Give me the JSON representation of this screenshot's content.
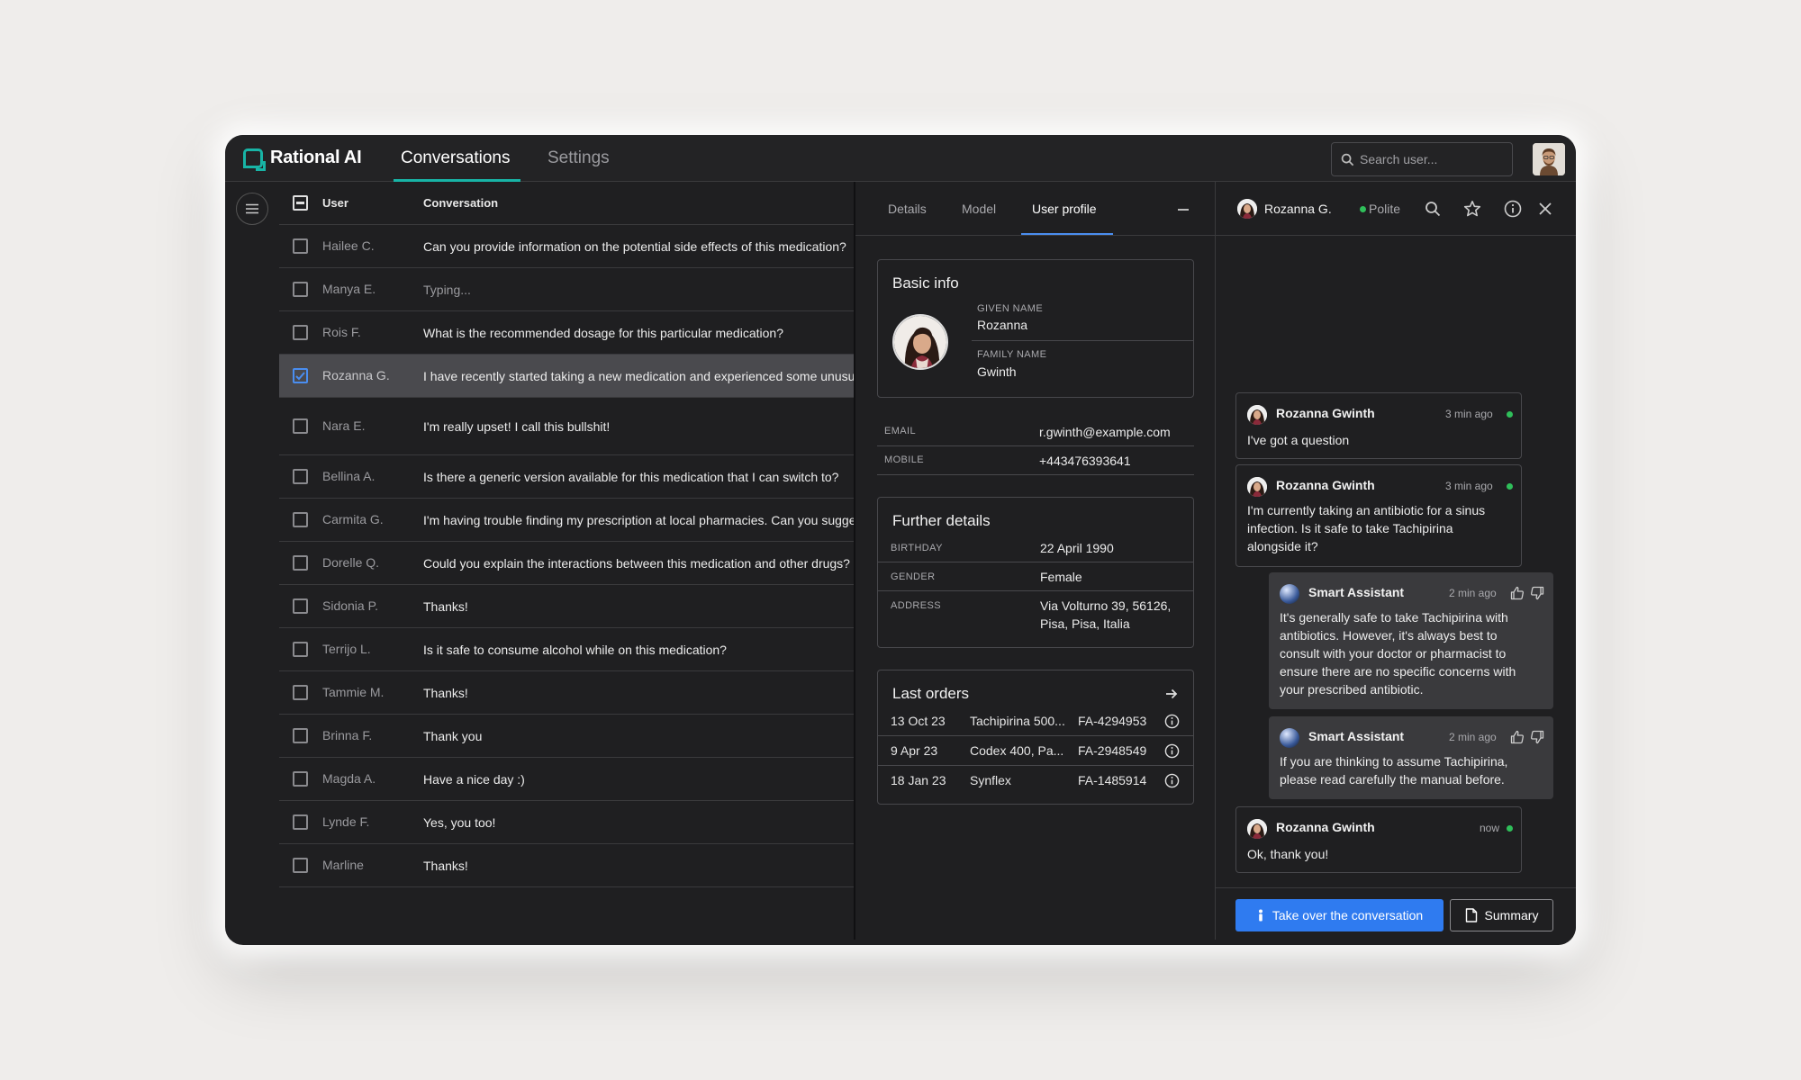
{
  "app": {
    "name": "Rational AI"
  },
  "nav": {
    "tabs": [
      "Conversations",
      "Settings"
    ]
  },
  "search": {
    "placeholder": "Search user..."
  },
  "table": {
    "headers": {
      "user": "User",
      "conversation": "Conversation"
    },
    "rows": [
      {
        "user": "Hailee C.",
        "text": "Can you provide information on the potential side effects of this medication?"
      },
      {
        "user": "Manya E.",
        "text": "Typing..."
      },
      {
        "user": "Rois F.",
        "text": "What is the recommended dosage for this particular medication?"
      },
      {
        "user": "Rozanna G.",
        "text": "I have recently started taking a new medication and experienced some unusual symptoms"
      },
      {
        "user": "Nara E.",
        "text": "I'm really upset! I call this bullshit!"
      },
      {
        "user": "Bellina A.",
        "text": "Is there a generic version available for this medication that I can switch to?"
      },
      {
        "user": "Carmita G.",
        "text": "I'm having trouble finding my prescription at local pharmacies. Can you suggest"
      },
      {
        "user": "Dorelle Q.",
        "text": "Could you explain the interactions between this medication and other drugs?"
      },
      {
        "user": "Sidonia P.",
        "text": "Thanks!"
      },
      {
        "user": "Terrijo L.",
        "text": "Is it safe to consume alcohol while on this medication?"
      },
      {
        "user": "Tammie M.",
        "text": "Thanks!"
      },
      {
        "user": "Brinna F.",
        "text": "Thank you"
      },
      {
        "user": "Magda A.",
        "text": "Have a nice day :)"
      },
      {
        "user": "Lynde F.",
        "text": "Yes, you too!"
      },
      {
        "user": "Marline",
        "text": "Thanks!"
      }
    ]
  },
  "profile": {
    "tabs": [
      "Details",
      "Model",
      "User profile"
    ],
    "basic_info": {
      "title": "Basic info",
      "given_label": "GIVEN NAME",
      "given": "Rozanna",
      "family_label": "FAMILY NAME",
      "family": "Gwinth"
    },
    "contact": {
      "email_label": "EMAIL",
      "email": "r.gwinth@example.com",
      "mobile_label": "MOBILE",
      "mobile": "+443476393641"
    },
    "further": {
      "title": "Further details",
      "birthday_label": "BIRTHDAY",
      "birthday": "22 April 1990",
      "gender_label": "GENDER",
      "gender": "Female",
      "address_label": "ADDRESS",
      "address_line1": "Via Volturno 39, 56126,",
      "address_line2": "Pisa, Pisa, Italia"
    },
    "orders": {
      "title": "Last orders",
      "items": [
        {
          "date": "13 Oct 23",
          "product": "Tachipirina 500...",
          "code": "FA-4294953"
        },
        {
          "date": "9 Apr 23",
          "product": "Codex 400, Pa...",
          "code": "FA-2948549"
        },
        {
          "date": "18 Jan 23",
          "product": "Synflex",
          "code": "FA-1485914"
        }
      ]
    }
  },
  "chat": {
    "user_name": "Rozanna G.",
    "tone": "Polite",
    "messages": [
      {
        "author": "Rozanna Gwinth",
        "time": "3 min ago",
        "lines": [
          "I've got a question"
        ]
      },
      {
        "author": "Rozanna Gwinth",
        "time": "3 min ago",
        "lines": [
          "I'm currently taking an antibiotic for a sinus",
          "infection. Is it safe to take Tachipirina",
          "alongside it?"
        ]
      },
      {
        "author": "Smart Assistant",
        "time": "2 min ago",
        "lines": [
          "It's generally safe to take Tachipirina with",
          "antibiotics. However, it's always best to",
          "consult with your doctor or pharmacist to",
          "ensure there are no specific concerns with",
          "your prescribed antibiotic."
        ]
      },
      {
        "author": "Smart Assistant",
        "time": "2 min ago",
        "lines": [
          "If you are thinking to assume Tachipirina,",
          "please read carefully the manual before."
        ]
      },
      {
        "author": "Rozanna Gwinth",
        "time": "now",
        "lines": [
          "Ok, thank you!"
        ]
      }
    ],
    "take_over_label": "Take over the conversation",
    "summary_label": "Summary"
  },
  "colors": {
    "accent": "#18b4a6",
    "primary": "#2f7bf0",
    "online": "#2fbf5a"
  }
}
